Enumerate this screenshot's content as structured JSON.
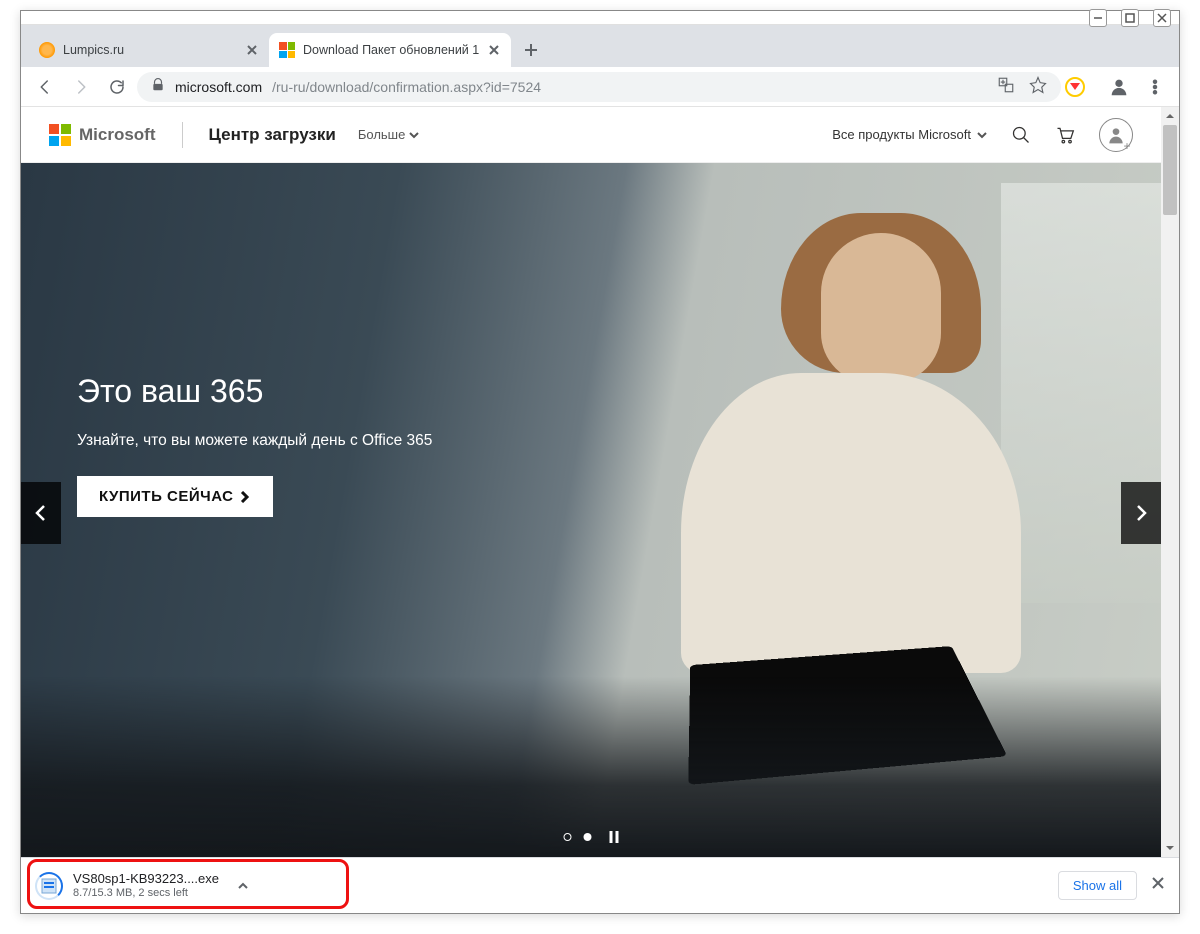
{
  "window": {
    "controls": {
      "minimize": "–",
      "maximize": "□",
      "close": "×"
    }
  },
  "tabs": [
    {
      "label": "Lumpics.ru",
      "active": false
    },
    {
      "label": "Download Пакет обновлений 1",
      "active": true
    }
  ],
  "omnibox": {
    "host": "microsoft.com",
    "path": "/ru-ru/download/confirmation.aspx?id=7524"
  },
  "ms_header": {
    "brand": "Microsoft",
    "center": "Центр загрузки",
    "more": "Больше",
    "all_products": "Все продукты Microsoft"
  },
  "hero": {
    "heading": "Это ваш 365",
    "sub": "Узнайте, что вы можете каждый день с Office 365",
    "cta": "КУПИТЬ СЕЙЧАС"
  },
  "carousel": {
    "index": 1,
    "count": 2
  },
  "download": {
    "filename": "VS80sp1-KB93223....exe",
    "status": "8.7/15.3 MB, 2 secs left",
    "show_all": "Show all"
  }
}
